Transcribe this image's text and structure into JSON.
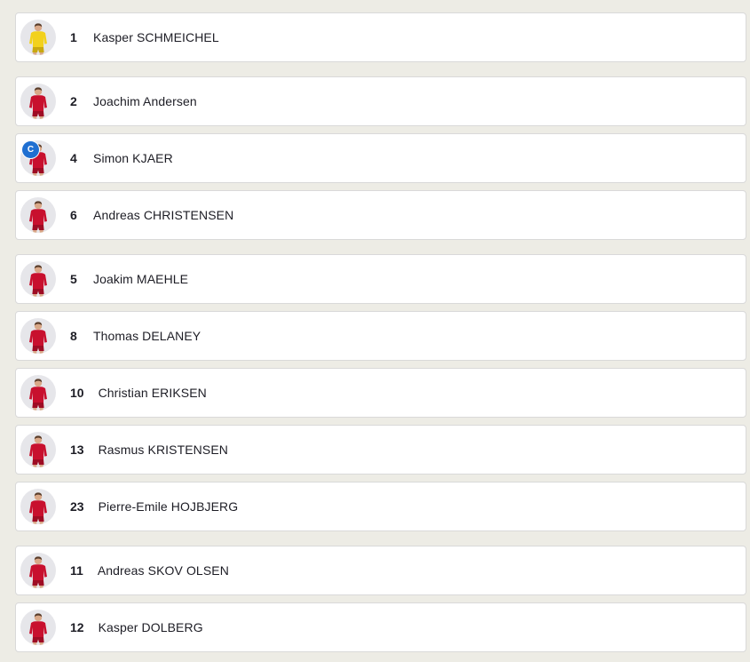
{
  "colors": {
    "page_background": "#edece5",
    "card_background": "#ffffff",
    "card_border": "#d9d9d9",
    "text": "#1d1d25",
    "captain_badge": "#1f6fd1",
    "goalkeeper_kit": "#f2d11c",
    "outfield_kit": "#c8102e"
  },
  "players": [
    {
      "number": "1",
      "name": "Kasper SCHMEICHEL",
      "kit": "goalkeeper",
      "captain": false
    },
    {
      "number": "2",
      "name": "Joachim Andersen",
      "kit": "outfield",
      "captain": false
    },
    {
      "number": "4",
      "name": "Simon KJAER",
      "kit": "outfield",
      "captain": true,
      "captain_label": "C"
    },
    {
      "number": "6",
      "name": "Andreas CHRISTENSEN",
      "kit": "outfield",
      "captain": false
    },
    {
      "number": "5",
      "name": "Joakim MAEHLE",
      "kit": "outfield",
      "captain": false
    },
    {
      "number": "8",
      "name": "Thomas DELANEY",
      "kit": "outfield",
      "captain": false
    },
    {
      "number": "10",
      "name": "Christian ERIKSEN",
      "kit": "outfield",
      "captain": false
    },
    {
      "number": "13",
      "name": "Rasmus KRISTENSEN",
      "kit": "outfield",
      "captain": false
    },
    {
      "number": "23",
      "name": "Pierre-Emile HOJBJERG",
      "kit": "outfield",
      "captain": false
    },
    {
      "number": "11",
      "name": "Andreas SKOV OLSEN",
      "kit": "outfield",
      "captain": false
    },
    {
      "number": "12",
      "name": "Kasper DOLBERG",
      "kit": "outfield",
      "captain": false
    }
  ]
}
